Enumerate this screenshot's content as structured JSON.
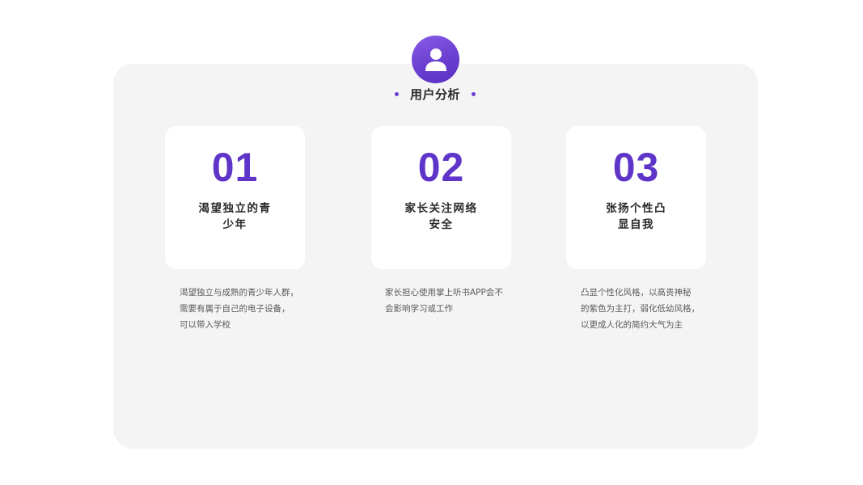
{
  "header": {
    "title": "用户分析",
    "icon": "user-icon",
    "accent_color": "#6a3fd0"
  },
  "cards": [
    {
      "number": "01",
      "label_lines": [
        "渴望独立的青",
        "少年"
      ],
      "description_lines": [
        "渴望独立与成熟的青少年人群，",
        "需要有属于自己的电子设备，",
        "可以带入学校"
      ]
    },
    {
      "number": "02",
      "label_lines": [
        "家长关注网络",
        "安全"
      ],
      "description_lines": [
        "家长担心使用掌上听书APP会不",
        "会影响学习或工作"
      ]
    },
    {
      "number": "03",
      "label_lines": [
        "张扬个性凸",
        "显自我"
      ],
      "description_lines": [
        "凸显个性化风格，以高贵神秘",
        "的紫色为主打，弱化低幼风格，",
        "以更成人化的简约大气为主"
      ]
    }
  ]
}
